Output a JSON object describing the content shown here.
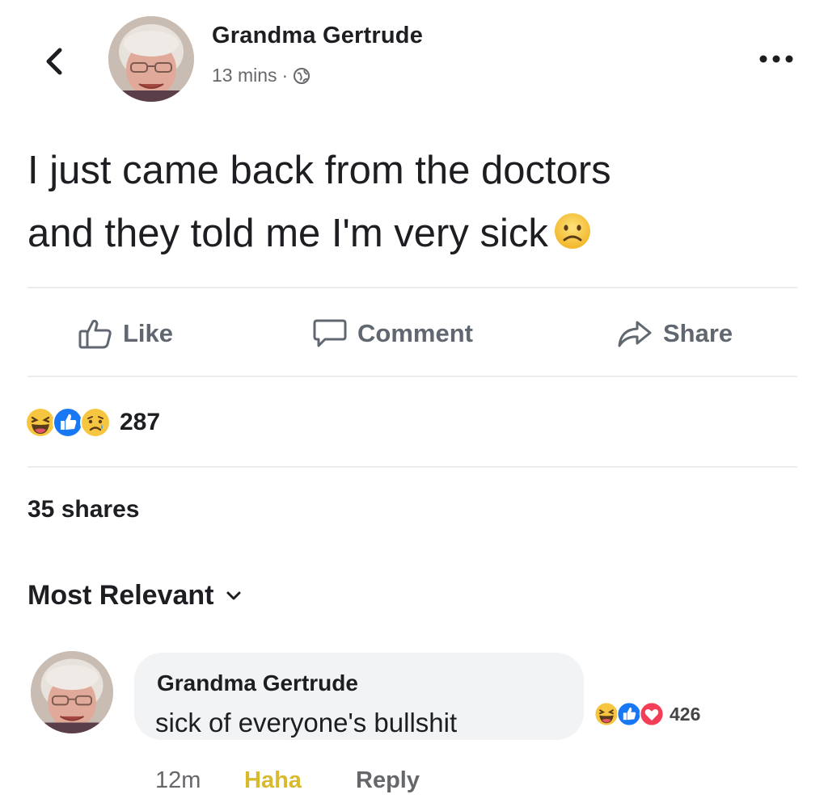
{
  "post": {
    "author": "Grandma Gertrude",
    "time": "13 mins",
    "separator": "·",
    "privacy_icon": "globe-icon",
    "text_line1": "I just came back from the doctors",
    "text_line2": "and they told me I'm very sick",
    "emoji": "sad-face-icon"
  },
  "actions": {
    "like_label": "Like",
    "comment_label": "Comment",
    "share_label": "Share"
  },
  "stats": {
    "reactions": [
      "haha",
      "like",
      "sad"
    ],
    "reaction_count": "287",
    "shares": "35 shares"
  },
  "comments_sort": {
    "label": "Most Relevant"
  },
  "comment": {
    "author": "Grandma Gertrude",
    "text": "sick of everyone's bullshit",
    "reactions": [
      "haha",
      "like",
      "love"
    ],
    "reaction_count": "426",
    "time": "12m",
    "haha_label": "Haha",
    "reply_label": "Reply"
  },
  "colors": {
    "text": "#1c1e21",
    "muted": "#65676b",
    "action": "#606770",
    "haha_active": "#d9b92d",
    "bubble": "#f2f3f5",
    "like_blue": "#1877f2",
    "love_red": "#f33e58",
    "emoji_yellow": "#f7c640"
  }
}
